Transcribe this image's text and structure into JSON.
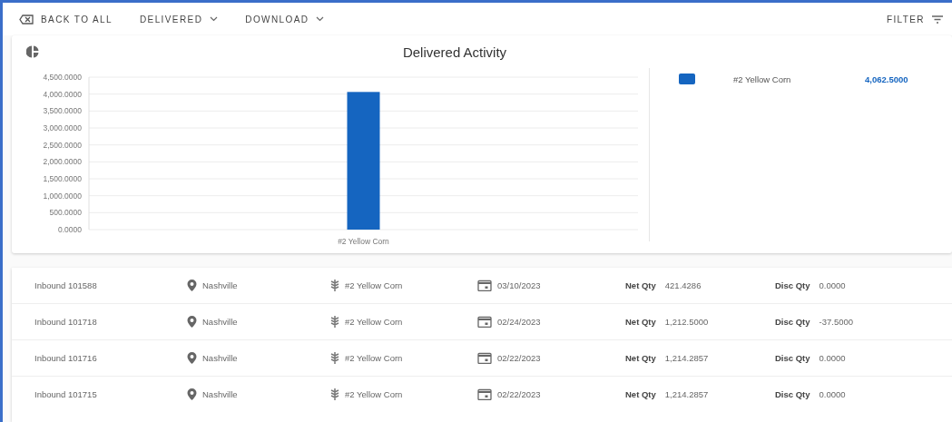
{
  "toolbar": {
    "back": {
      "label": "BACK TO ALL"
    },
    "menus": [
      {
        "label": "DELIVERED"
      },
      {
        "label": "DOWNLOAD"
      }
    ],
    "filter": {
      "label": "FILTER"
    }
  },
  "chart_card": {
    "title": "Delivered Activity",
    "chart_data": {
      "type": "bar",
      "grid": true,
      "categories": [
        "#2 Yellow Corn"
      ],
      "series": [
        {
          "name": "#2 Yellow Corn",
          "color": "#1565c0",
          "values": [
            4062.5
          ]
        }
      ],
      "ylim": [
        0,
        4500
      ],
      "yticks": [
        {
          "value": 0,
          "label": "0.0000"
        },
        {
          "value": 500,
          "label": "500.0000"
        },
        {
          "value": 1000,
          "label": "1,000.0000"
        },
        {
          "value": 1500,
          "label": "1,500.0000"
        },
        {
          "value": 2000,
          "label": "2,000.0000"
        },
        {
          "value": 2500,
          "label": "2,500.0000"
        },
        {
          "value": 3000,
          "label": "3,000.0000"
        },
        {
          "value": 3500,
          "label": "3,500.0000"
        },
        {
          "value": 4000,
          "label": "4,000.0000"
        },
        {
          "value": 4500,
          "label": "4,500.0000"
        }
      ]
    },
    "legend": [
      {
        "value": "4,062.5000"
      }
    ]
  },
  "rows": [
    {
      "id": "Inbound 101588",
      "location": "Nashville",
      "product": "#2 Yellow Corn",
      "date": "03/10/2023",
      "net_label": "Net Qty",
      "net_qty": "421.4286",
      "disc_label": "Disc Qty",
      "disc_qty": "0.0000"
    },
    {
      "id": "Inbound 101718",
      "location": "Nashville",
      "product": "#2 Yellow Corn",
      "date": "02/24/2023",
      "net_label": "Net Qty",
      "net_qty": "1,212.5000",
      "disc_label": "Disc Qty",
      "disc_qty": "-37.5000"
    },
    {
      "id": "Inbound 101716",
      "location": "Nashville",
      "product": "#2 Yellow Corn",
      "date": "02/22/2023",
      "net_label": "Net Qty",
      "net_qty": "1,214.2857",
      "disc_label": "Disc Qty",
      "disc_qty": "0.0000"
    },
    {
      "id": "Inbound 101715",
      "location": "Nashville",
      "product": "#2 Yellow Corn",
      "date": "02/22/2023",
      "net_label": "Net Qty",
      "net_qty": "1,214.2857",
      "disc_label": "Disc Qty",
      "disc_qty": "0.0000"
    }
  ]
}
